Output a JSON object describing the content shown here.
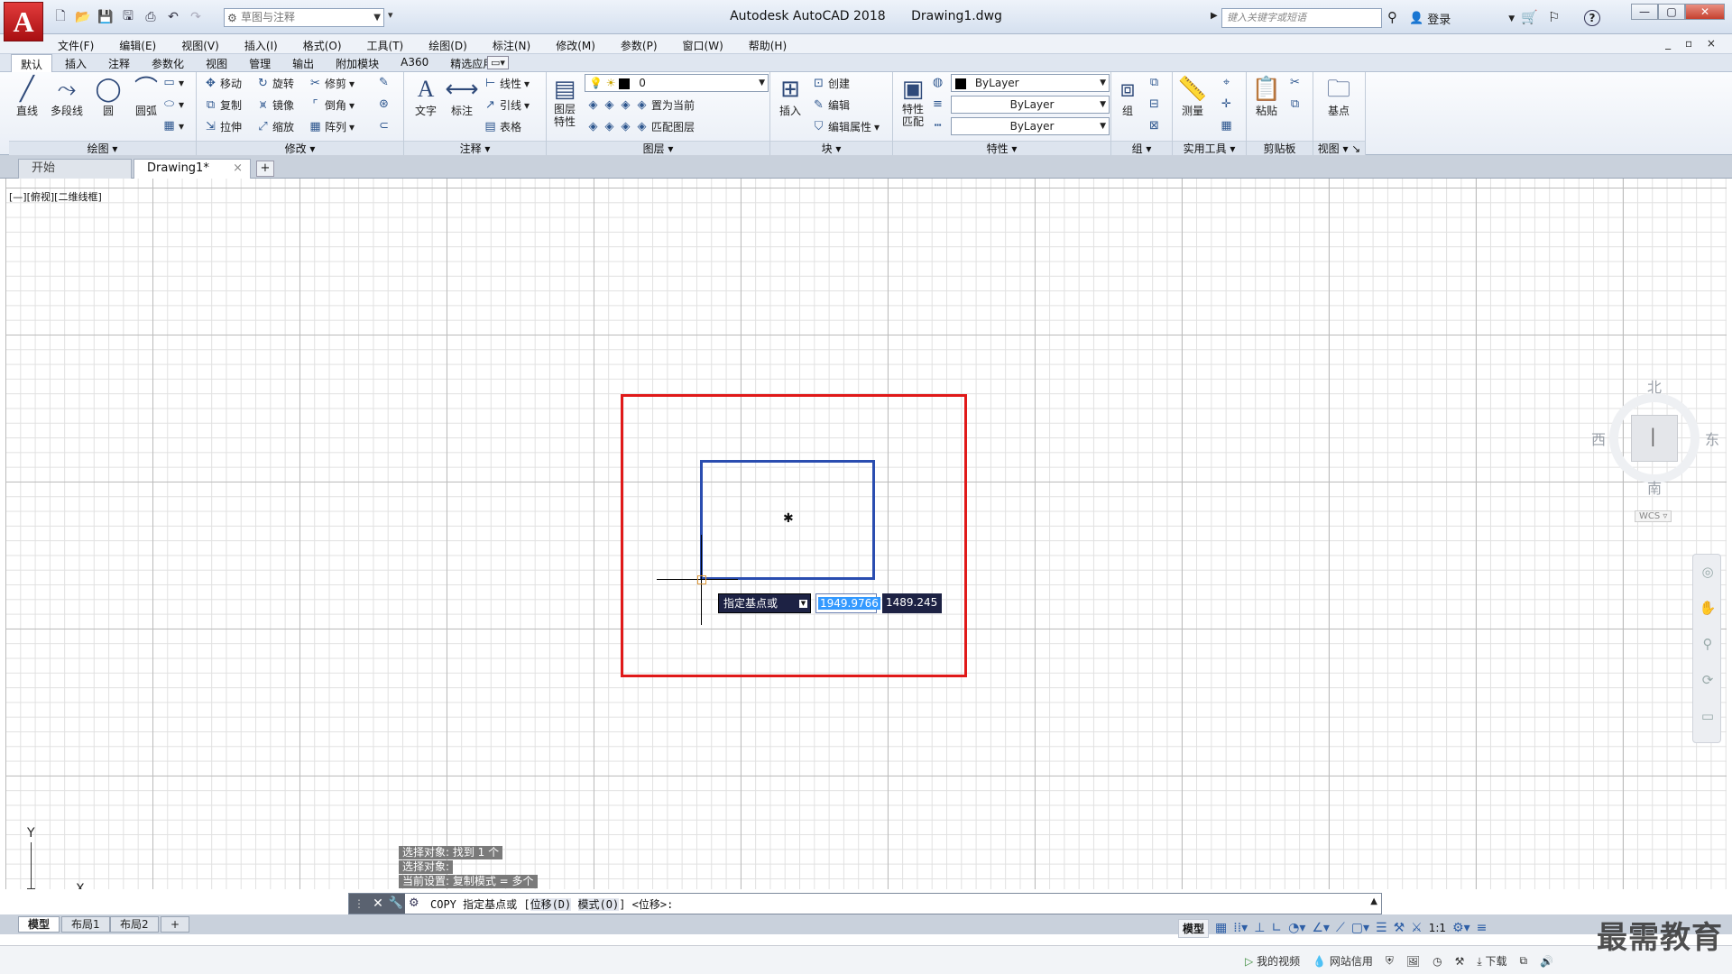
{
  "app": {
    "logo": "A",
    "title": "Autodesk AutoCAD 2018",
    "file": "Drawing1.dwg",
    "workspace": "草图与注释",
    "search_placeholder": "键入关键字或短语",
    "login": "登录",
    "help": "?"
  },
  "window": {
    "min": "—",
    "max": "▢",
    "close": "✕",
    "mdi": "_ ▫ ×"
  },
  "menu": [
    "文件(F)",
    "编辑(E)",
    "视图(V)",
    "插入(I)",
    "格式(O)",
    "工具(T)",
    "绘图(D)",
    "标注(N)",
    "修改(M)",
    "参数(P)",
    "窗口(W)",
    "帮助(H)"
  ],
  "ribbon_tabs": [
    "默认",
    "插入",
    "注释",
    "参数化",
    "视图",
    "管理",
    "输出",
    "附加模块",
    "A360",
    "精选应用"
  ],
  "ribbon": {
    "draw": {
      "title": "绘图",
      "line": "直线",
      "polyline": "多段线",
      "circle": "圆",
      "arc": "圆弧"
    },
    "modify": {
      "title": "修改",
      "move": "移动",
      "rotate": "旋转",
      "trim": "修剪",
      "copy": "复制",
      "mirror": "镜像",
      "fillet": "倒角",
      "stretch": "拉伸",
      "scale": "缩放",
      "array": "阵列"
    },
    "annotation": {
      "title": "注释",
      "text": "文字",
      "dimension": "标注",
      "linear": "线性",
      "leader": "引线",
      "table": "表格"
    },
    "layers": {
      "title": "图层",
      "layer_props": "图层\n特性",
      "layer_name": "0",
      "set_current": "置为当前",
      "match_layer": "匹配图层"
    },
    "block": {
      "title": "块",
      "insert": "插入",
      "create": "创建",
      "edit": "编辑",
      "edit_attr": "编辑属性"
    },
    "properties": {
      "title": "特性",
      "match": "特性\n匹配",
      "color": "ByLayer",
      "linetype": "ByLayer",
      "lineweight": "ByLayer"
    },
    "group": {
      "title": "组",
      "group": "组"
    },
    "utilities": {
      "title": "实用工具",
      "measure": "测量"
    },
    "clipboard": {
      "title": "剪贴板",
      "paste": "粘贴"
    },
    "view": {
      "title": "视图",
      "base": "基点"
    }
  },
  "file_tabs": [
    {
      "label": "开始"
    },
    {
      "label": "Drawing1*"
    }
  ],
  "viewport_label": "[—][俯视][二维线框]",
  "dynamic_input": {
    "prompt": "指定基点或",
    "x": "1949.9766",
    "y": "1489.245"
  },
  "ucs": {
    "x": "X",
    "y": "Y"
  },
  "viewcube": {
    "north": "北",
    "south": "南",
    "west": "西",
    "east": "东",
    "wcs": "WCS ▿"
  },
  "command_history": [
    "选择对象: 找到 1 个",
    "选择对象:",
    "当前设置:  复制模式 = 多个"
  ],
  "command_line": {
    "prefix": "COPY 指定基点或 [",
    "opt1": "位移(D)",
    "opt2": "模式(O)",
    "suffix": "] <位移>:"
  },
  "layout_tabs": [
    "模型",
    "布局1",
    "布局2"
  ],
  "status": {
    "model": "模型",
    "scale": "1:1"
  },
  "taskbar": {
    "video": "我的视频",
    "credit": "网站信用",
    "download": "下载"
  },
  "watermark": "最需教育"
}
